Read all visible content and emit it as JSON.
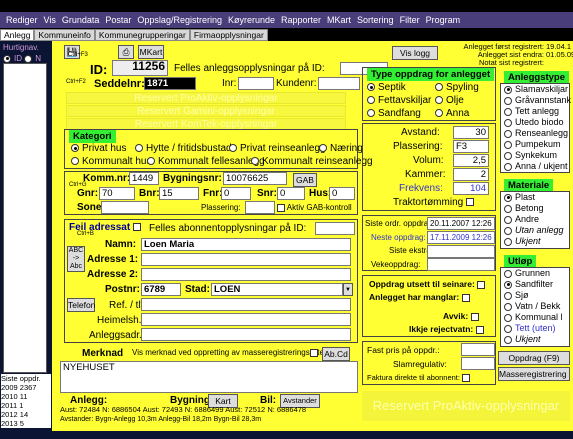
{
  "menu": [
    "Rediger",
    "Vis",
    "Grundata",
    "Postar",
    "Oppslag/Registrering",
    "Køyrerunde",
    "Rapporter",
    "MKart",
    "Sortering",
    "Filter",
    "Program"
  ],
  "tabs": [
    "Anlegg",
    "Kommuneinfo",
    "Kommunegrupperingar",
    "Firmaopplysningar"
  ],
  "left": {
    "title": "Hurtignav.",
    "opt1": "ID",
    "opt2": "N",
    "opt3": "S",
    "footer": "Siste oppdr.",
    "years": [
      [
        "2009",
        "2367"
      ],
      [
        "2010",
        "11"
      ],
      [
        "2011",
        "1"
      ],
      [
        "2012",
        "14"
      ],
      [
        "2013",
        "5"
      ]
    ]
  },
  "top": {
    "mkart": "MKart",
    "id_label": "ID:",
    "id_value": "11256",
    "ctrl_f3": "Ctrl+F3",
    "felles": "Felles anleggsopplysningar på ID:",
    "vis_logg": "Vis logg",
    "reg_first": "Anlegget først registrert:",
    "reg_first_v": "19.04.1",
    "reg_changed": "Anlegget sist endra:",
    "reg_changed_v": "01.05.09",
    "note": "Notat sist registrert:"
  },
  "seddel": {
    "ctrl_f2": "Ctrl+F2",
    "label": "Seddelnr:",
    "value": "1871",
    "inr": "Inr:",
    "kundenr": "Kundenr:"
  },
  "ghost": [
    "Reservert ProAktiv-opplysningar",
    "Reservert Gamini-opplysningar",
    "Reservert KomTek-opplysningar"
  ],
  "kategori": {
    "title": "Kategori",
    "items": [
      "Privat hus",
      "Hytte / fritidsbustad",
      "Privat reinseanlegg",
      "Næring",
      "Kommunalt hus",
      "Kommunalt fellesanlegg",
      "Kommunalt reinseanlegg"
    ]
  },
  "komm": {
    "label": "Komm.nr:",
    "value": "1449",
    "byg_label": "Bygningsnr:",
    "byg_value": "10076625",
    "gab": "GAB",
    "ctrl_g": "Ctrl+G",
    "gnr": "Gnr:",
    "gnr_v": "70",
    "bnr": "Bnr:",
    "bnr_v": "15",
    "fnr": "Fnr:",
    "fnr_v": "0",
    "snr": "Snr:",
    "snr_v": "0",
    "hus": "Hus:",
    "hus_v": "0",
    "sone": "Sone:",
    "plassering": "Plassering:",
    "aktiv_gab": "Aktiv GAB-kontroll"
  },
  "adresse": {
    "feil": "Feil adressat",
    "felles": "Felles abonnentopplysningar på ID:",
    "ctrl_b": "Ctrl+B",
    "abc": "ABC -> Abc",
    "namn": "Namn:",
    "namn_v": "Loen Maria",
    "adr1": "Adresse 1:",
    "adr2": "Adresse 2:",
    "postnr": "Postnr:",
    "postnr_v": "6789",
    "stad": "Stad:",
    "stad_v": "LOEN",
    "telefon": "Telefon",
    "ref": "Ref. / tlf:",
    "heimelsh": "Heimelsh.:",
    "anleggsadr": "Anleggsadr.:"
  },
  "merknad": {
    "label": "Merknad",
    "vis": "Vis merknad ved oppretting av masseregistreringsliste",
    "abcd": "Ab.Cd",
    "value": "NYEHUSET"
  },
  "bottom_row": {
    "anlegg": "Anlegg:",
    "bygning": "Bygning:",
    "kart": "Kart",
    "bil": "Bil:",
    "avstander": "Avstander",
    "aust1": "Aust: 72484",
    "n1": "N: 6886504",
    "aust2": "Aust: 72493",
    "n2": "N: 6886499",
    "aust3": "Aust: 72512",
    "n3": "N: 6886478",
    "status1": "Avstander: Bygn-Anlegg 10,3m",
    "status2": "Anlegg-Bil 18,2m",
    "status3": "Bygn-Bil 28,3m"
  },
  "oppdrag": {
    "title": "Type oppdrag for anlegget",
    "items": [
      "Septik",
      "Spyling",
      "Fettavskiljar",
      "Olje",
      "Sandfang",
      "Anna"
    ]
  },
  "avstand": {
    "avstand": "Avstand:",
    "avstand_v": "30",
    "plassering": "Plassering:",
    "plassering_v": "F3",
    "volum": "Volum:",
    "volum_v": "2,5",
    "kammer": "Kammer:",
    "kammer_v": "2",
    "frekvens": "Frekvens:",
    "frekvens_v": "104",
    "trakt": "Traktortømming"
  },
  "siste": {
    "siste": "Siste ordr. oppdrag:",
    "siste_v": "20.11.2007 12:26",
    "neste": "Neste oppdrag:",
    "neste_v": "17.11.2009 12:26",
    "ekstra": "Siste ekstra:",
    "veke": "Vekeoppdrag:"
  },
  "flags": {
    "utsett": "Oppdrag utsett til seinare:",
    "manglar": "Anlegget har manglar:",
    "avvik": "Avvik:",
    "reject": "Ikkje rejectvatn:"
  },
  "fast": {
    "fast": "Fast pris på oppdr.:",
    "slam": "Slamregulativ:",
    "faktura": "Faktura direkte til abonnent:"
  },
  "anleggstype": {
    "title": "Anleggstype",
    "items": [
      "Slamavskiljar",
      "Gråvannstank",
      "Tett anlegg",
      "Utedo biodo",
      "Renseanlegg",
      "Pumpekum",
      "Synkekum",
      "Anna / ukjent"
    ]
  },
  "materiale": {
    "title": "Materiale",
    "items": [
      "Plast",
      "Betong",
      "Andre",
      "Utan anlegg",
      "Ukjent"
    ]
  },
  "utlop": {
    "title": "Utløp",
    "items": [
      "Grunnen",
      "Sandfilter",
      "Sjø",
      "Vatn / Bekk",
      "Kommunal l",
      "Tett (uten)",
      "Ukjent"
    ]
  },
  "buttons": {
    "oppdrag": "Oppdrag (F9)",
    "masseregistrering": "Masseregistrering (F10)"
  },
  "ghost_big": "Reservert ProAktiv-opplysningar"
}
